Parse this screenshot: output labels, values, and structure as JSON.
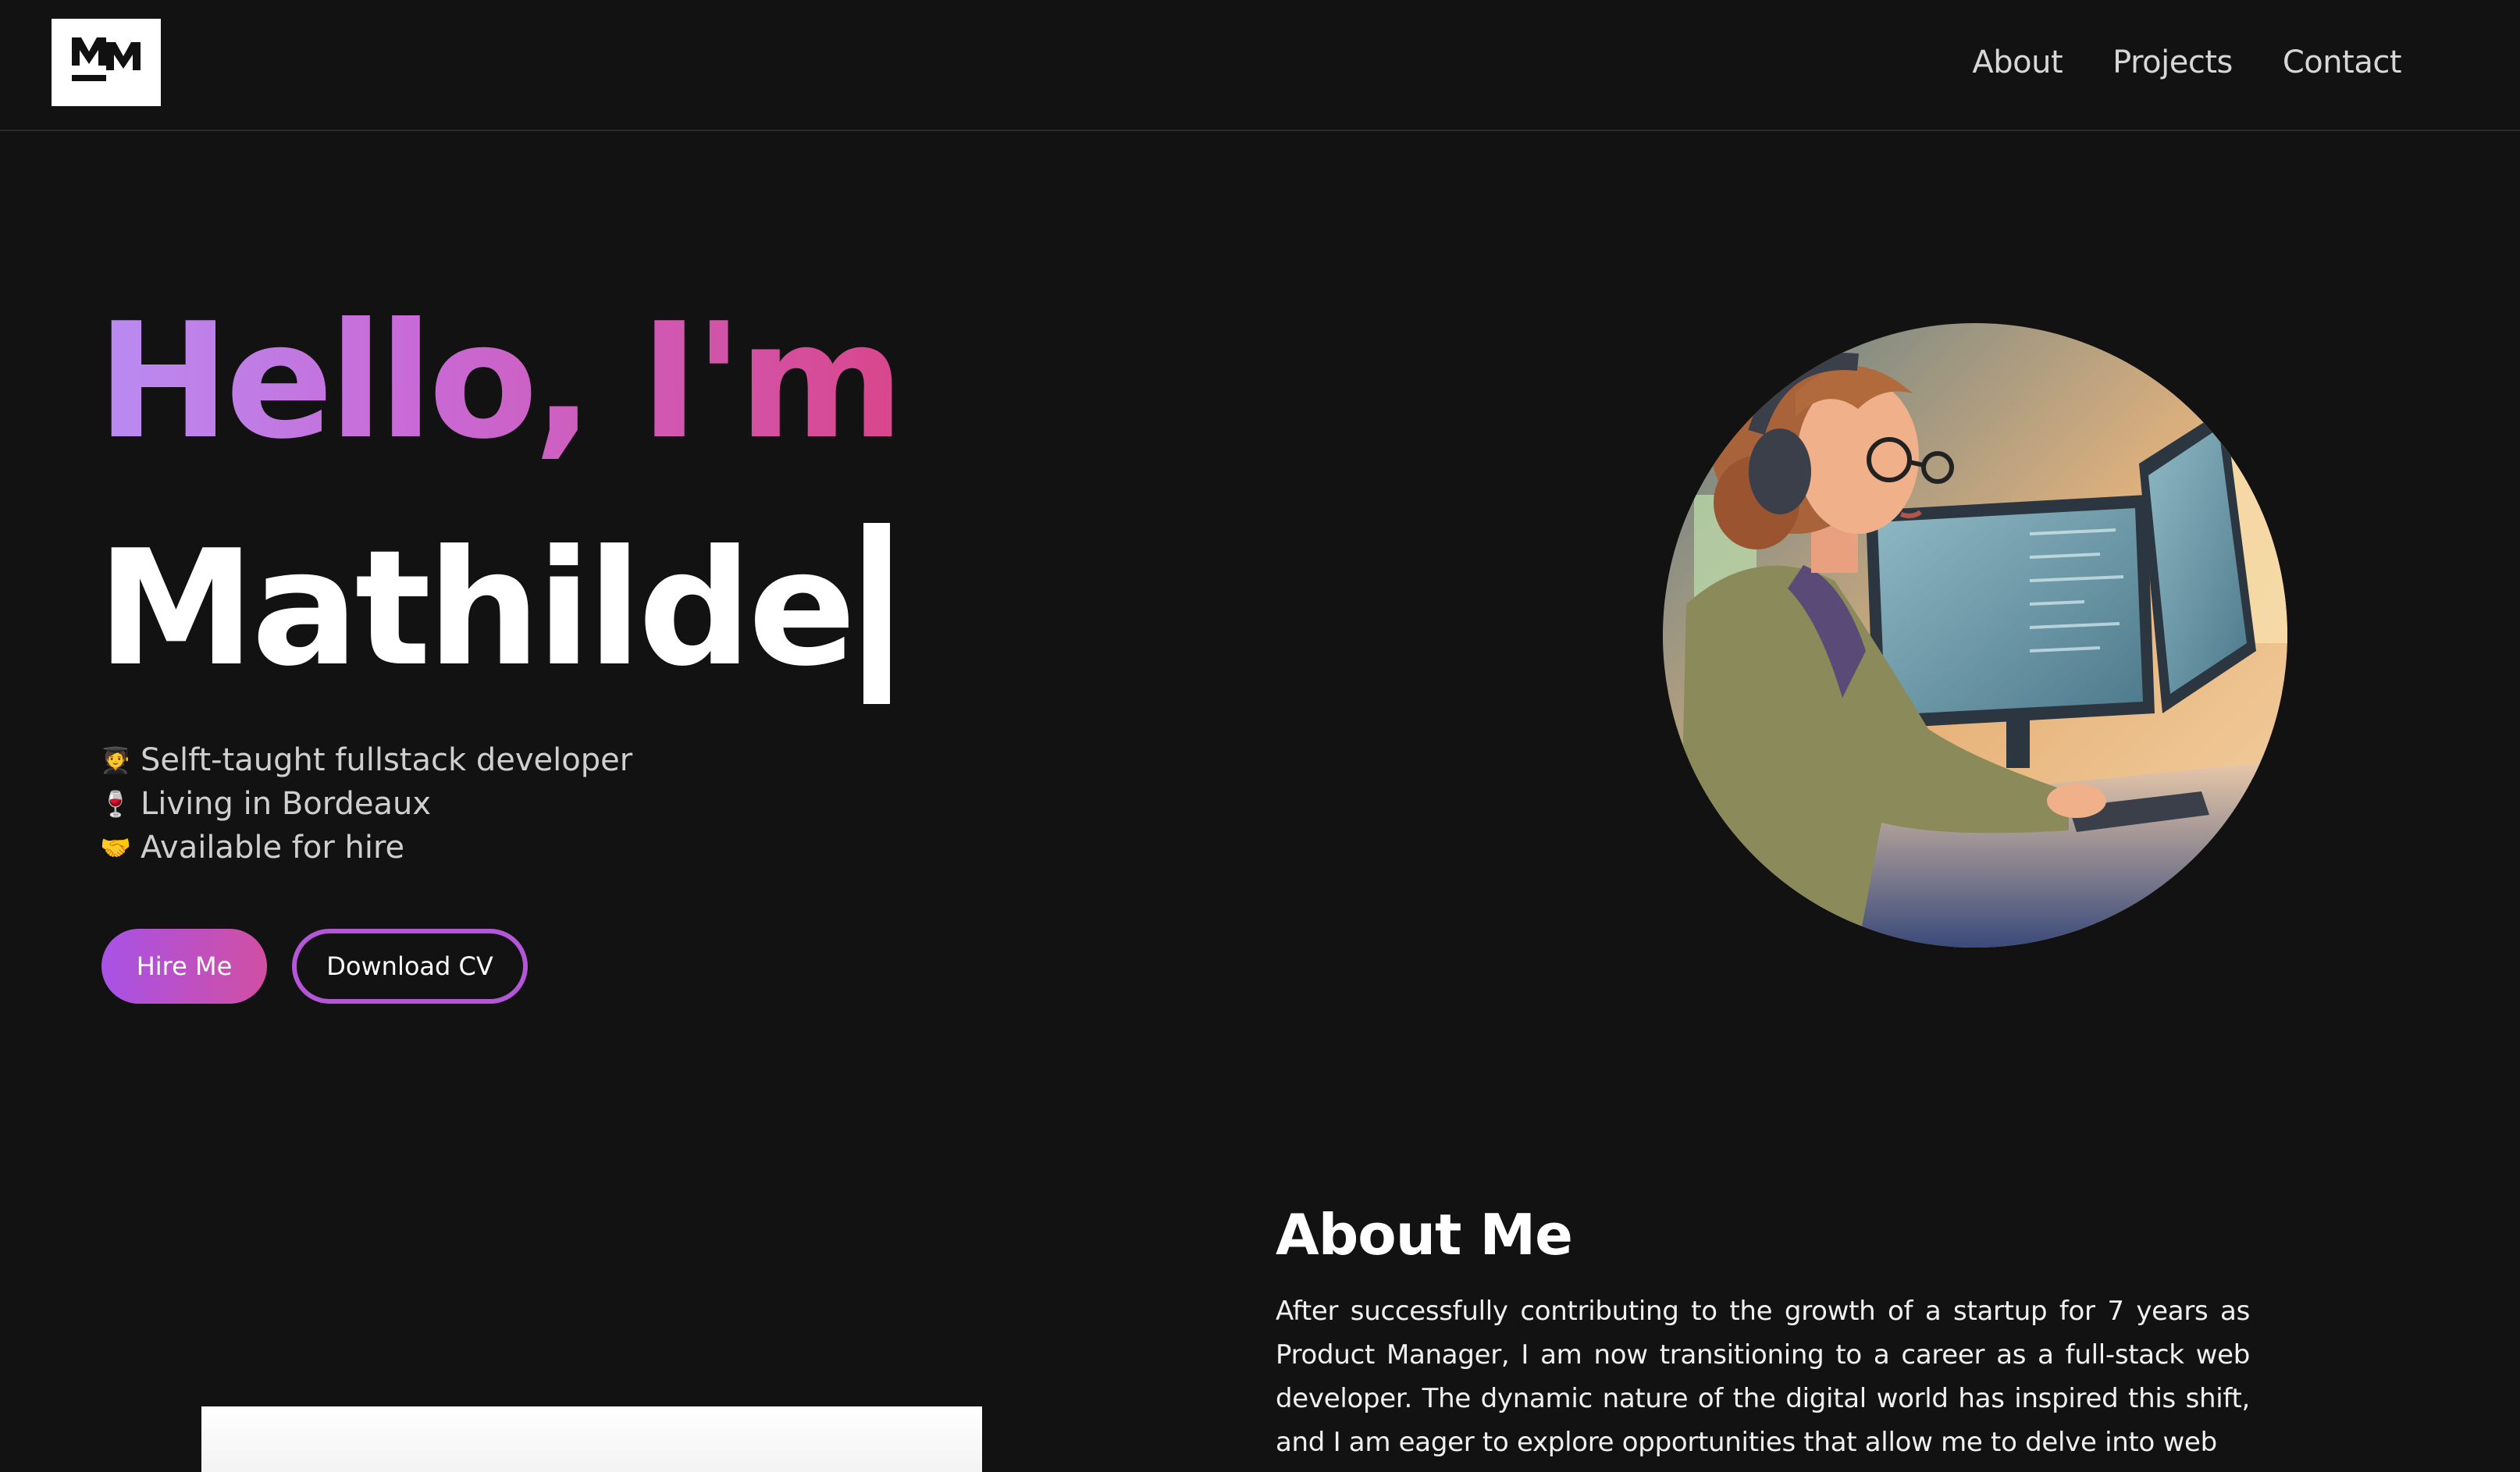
{
  "header": {
    "logo_text": "MM",
    "nav": [
      {
        "label": "About"
      },
      {
        "label": "Projects"
      },
      {
        "label": "Contact"
      }
    ]
  },
  "hero": {
    "greeting": "Hello, I'm",
    "name": "Mathilde",
    "facts": [
      {
        "icon": "student-icon",
        "emoji": "🧑‍🎓",
        "text": "Selft-taught fullstack developer"
      },
      {
        "icon": "wine-glass-icon",
        "emoji": "🍷",
        "text": "Living in Bordeaux"
      },
      {
        "icon": "handshake-icon",
        "emoji": "🤝",
        "text": "Available for hire"
      }
    ],
    "buttons": {
      "hire": "Hire Me",
      "cv": "Download CV"
    }
  },
  "about": {
    "title": "About Me",
    "text": "After successfully contributing to the growth of a startup for 7 years as Product Manager, I am now transitioning to a career as a full-stack web developer. The dynamic nature of the digital world has inspired this shift, and I am eager to explore opportunities that allow me to delve into web"
  },
  "colors": {
    "background": "#121212",
    "accent_start": "#a852e6",
    "accent_end": "#d14fa2"
  }
}
